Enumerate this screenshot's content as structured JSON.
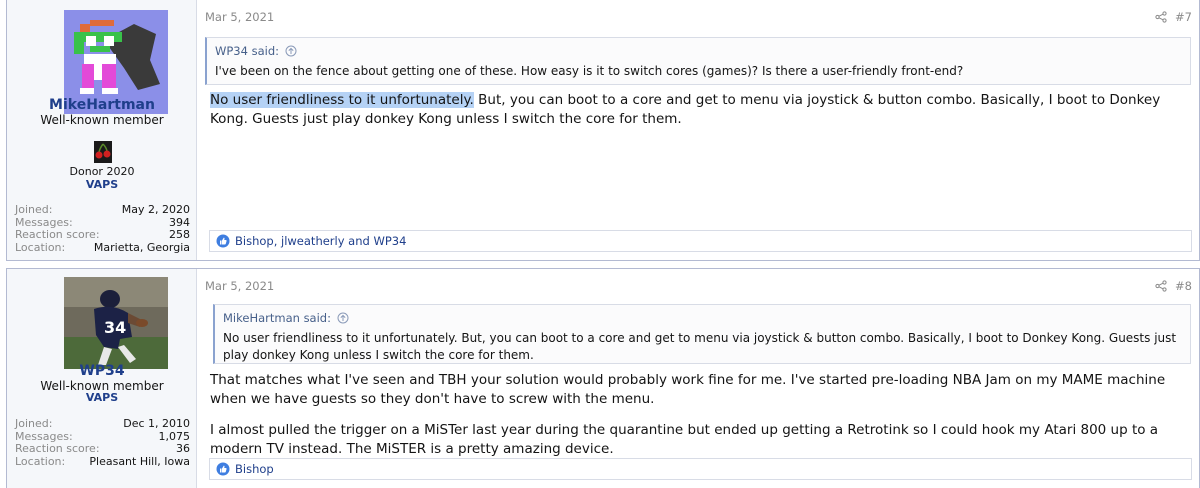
{
  "posts": [
    {
      "user": {
        "username": "MikeHartman",
        "title": "Well-known member",
        "badge_icon": "cherry-icon",
        "donor": "Donor 2020",
        "group": "VAPS",
        "stats": [
          {
            "label": "Joined:",
            "value": "May 2, 2020"
          },
          {
            "label": "Messages:",
            "value": "394"
          },
          {
            "label": "Reaction score:",
            "value": "258"
          },
          {
            "label": "Location:",
            "value": "Marietta, Georgia"
          }
        ]
      },
      "date": "Mar 5, 2021",
      "post_number": "#7",
      "quote": {
        "author": "WP34 said:",
        "text": "I've been on the fence about getting one of these. How easy is it to switch cores (games)? Is there a user-friendly front-end?"
      },
      "message": {
        "highlighted": "No user friendliness to it unfortunately.",
        "rest": " But, you can boot to a core and get to menu via joystick & button combo. Basically, I boot to Donkey Kong. Guests just play donkey Kong unless I switch the core for them."
      },
      "reactions": "Bishop, jlweatherly and WP34"
    },
    {
      "user": {
        "username": "WP34",
        "title": "Well-known member",
        "group": "VAPS",
        "stats": [
          {
            "label": "Joined:",
            "value": "Dec 1, 2010"
          },
          {
            "label": "Messages:",
            "value": "1,075"
          },
          {
            "label": "Reaction score:",
            "value": "36"
          },
          {
            "label": "Location:",
            "value": "Pleasant Hill, Iowa"
          }
        ]
      },
      "date": "Mar 5, 2021",
      "post_number": "#8",
      "quote": {
        "author": "MikeHartman said:",
        "text": "No user friendliness to it unfortunately. But, you can boot to a core and get to menu via joystick & button combo. Basically, I boot to Donkey Kong. Guests just play donkey Kong unless I switch the core for them."
      },
      "message": {
        "para1": "That matches what I've seen and TBH your solution would probably work fine for me. I've started pre-loading NBA Jam on my MAME machine when we have guests so they don't have to screw with the menu.",
        "para2": "I almost pulled the trigger on a MiSTer last year during the quarantine but ended up getting a Retrotink so I could hook my Atari 800 up to a modern TV instead. The MiSTER is a pretty amazing device."
      },
      "reactions": "Bishop"
    }
  ],
  "colors": {
    "username": "#1f3f8b",
    "sidebar_bg": "#f5f7fa",
    "border": "#b3bad2",
    "highlight": "#b5d2f5"
  }
}
